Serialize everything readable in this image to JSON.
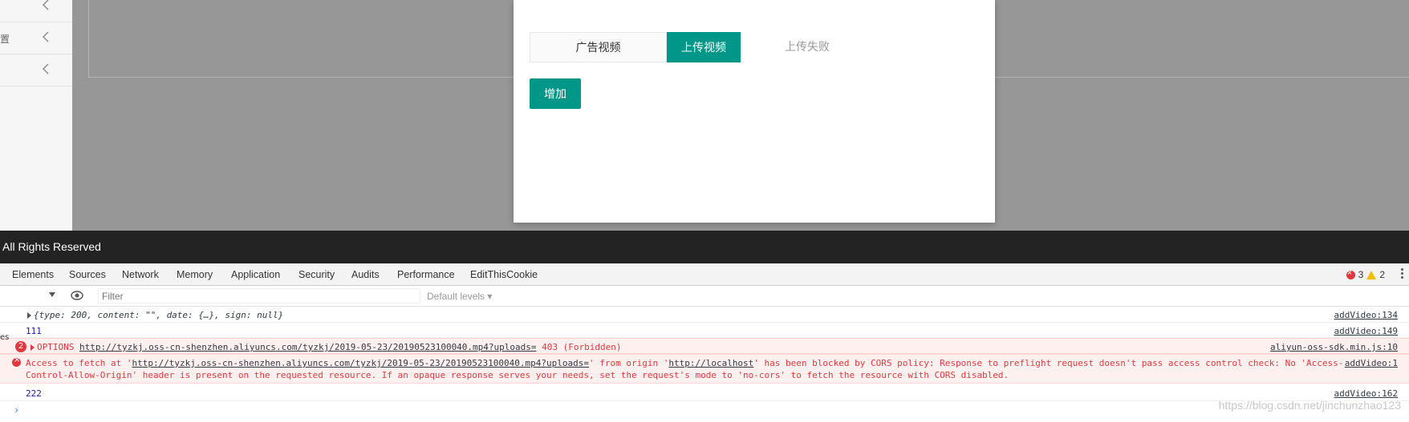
{
  "sidebar": {
    "fragment_char": "置"
  },
  "modal": {
    "tabs": [
      {
        "label": "广告视频",
        "active": false
      },
      {
        "label": "上传视频",
        "active": true
      }
    ],
    "status_text": "上传失败",
    "add_button_label": "增加",
    "accent_color": "#009688"
  },
  "footer": {
    "text": "All Rights Reserved"
  },
  "devtools": {
    "tabs": [
      "Elements",
      "Sources",
      "Network",
      "Memory",
      "Application",
      "Security",
      "Audits",
      "Performance",
      "EditThisCookie"
    ],
    "error_count": "3",
    "warning_count": "2",
    "filter_placeholder": "Filter",
    "levels_label": "Default levels ▾",
    "left_edge_fragment": "es",
    "console": {
      "row1": {
        "text": "{type: 200, content: \"\", date: {…}, sign: null}",
        "source": "addVideo:134"
      },
      "row2": {
        "text": "111",
        "source": "addVideo:149"
      },
      "row3": {
        "badge": "2",
        "method": "OPTIONS",
        "url": "http://tyzkj.oss-cn-shenzhen.aliyuncs.com/tyzkj/2019-05-23/20190523100040.mp4?uploads=",
        "status": "403 (Forbidden)",
        "source": "aliyun-oss-sdk.min.js:10"
      },
      "row4": {
        "prefix": "Access to fetch at '",
        "url": "http://tyzkj.oss-cn-shenzhen.aliyuncs.com/tyzkj/2019-05-23/20190523100040.mp4?uploads=",
        "mid": "' from origin '",
        "origin": "http://localhost",
        "suffix": "' has been blocked by CORS policy: Response to preflight request doesn't pass access control check: No 'Access-",
        "line2": "Control-Allow-Origin' header is present on the requested resource. If an opaque response serves your needs, set the request's mode to 'no-cors' to fetch the resource with CORS disabled.",
        "source": "addVideo:1"
      },
      "row5": {
        "text": "222",
        "source": "addVideo:162"
      },
      "prompt": "›"
    }
  },
  "watermark": "https://blog.csdn.net/jinchunzhao123"
}
